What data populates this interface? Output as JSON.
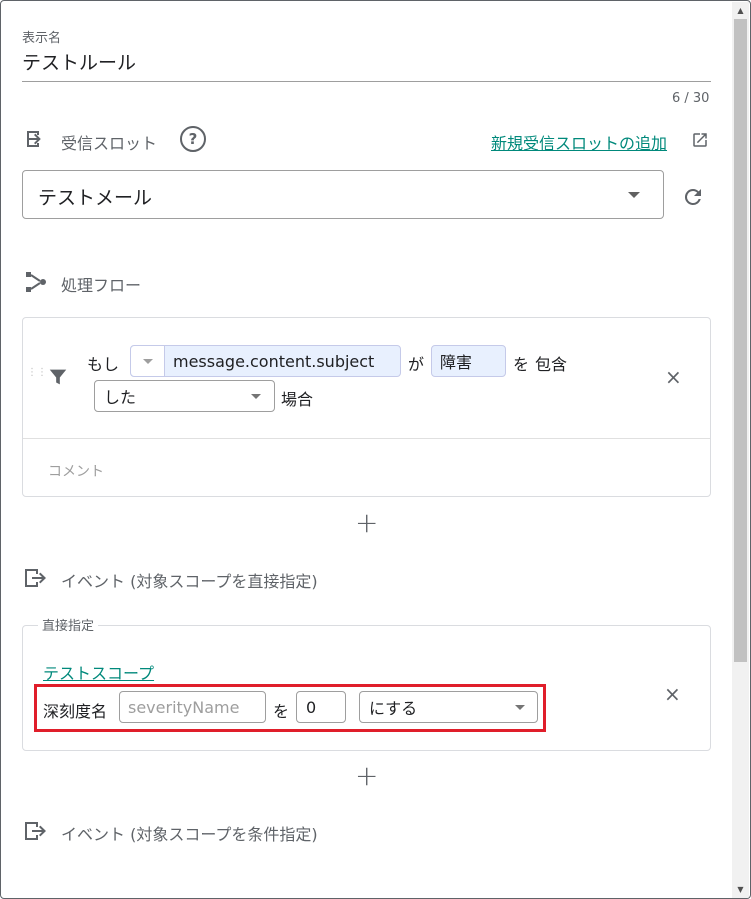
{
  "display_name": {
    "label": "表示名",
    "value": "テストルール",
    "counter": "6 / 30"
  },
  "receive_slot": {
    "title": "受信スロット",
    "add_link": "新規受信スロットの追加",
    "selected": "テストメール"
  },
  "flow": {
    "title": "処理フロー",
    "condition": {
      "prefix": "もし",
      "field": "message.content.subject",
      "particle_ga": "が",
      "keyword": "障害",
      "particle_wo": "を",
      "operator": "包含",
      "mode": "した",
      "suffix": "場合"
    },
    "comment_placeholder": "コメント"
  },
  "event_direct": {
    "title": "イベント (対象スコープを直接指定)",
    "group_label": "直接指定",
    "scope_link": "テストスコープ",
    "attr_label": "深刻度名",
    "attr_placeholder": "severityName",
    "particle_wo": "を",
    "value": "0",
    "action": "にする"
  },
  "event_conditional": {
    "title": "イベント (対象スコープを条件指定)"
  },
  "icons": {
    "help": "?",
    "close": "×",
    "add": "+"
  },
  "colors": {
    "link": "#00897b",
    "highlight": "#e01e2a",
    "chip_bg": "#e8f0fe"
  }
}
